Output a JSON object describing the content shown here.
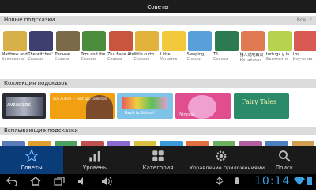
{
  "topbar": {
    "title": "Советы"
  },
  "new_tips": {
    "title": "Новые подсказки",
    "more_label": "Все",
    "items": [
      {
        "name": "Matthew and",
        "price": "Бесплатно",
        "color": "#d8b04a"
      },
      {
        "name": "The witches'",
        "price": "Сказки",
        "color": "#3d3f6e"
      },
      {
        "name": "Лесные",
        "price": "Сказки",
        "color": "#7a6a4a"
      },
      {
        "name": "Tom and the",
        "price": "Сказки",
        "color": "#4c8c3c"
      },
      {
        "name": "Zhu Bajie Ate",
        "price": "Сказки",
        "color": "#c9553e"
      },
      {
        "name": "little cutto",
        "price": "Сказки",
        "color": "#e2b23a"
      },
      {
        "name": "Little",
        "price": "Узнайте",
        "color": "#f2c93a"
      },
      {
        "name": "Sleeping",
        "price": "Сказки",
        "color": "#5aa0d8"
      },
      {
        "name": "T5",
        "price": "Сказки",
        "color": "#2c7a50"
      },
      {
        "name": "猪八戒吃西瓜",
        "price": "Китайская",
        "color": "#e07a52"
      },
      {
        "name": "tortuga y la",
        "price": "Бесплатно",
        "color": "#b7d24c"
      },
      {
        "name": "Los",
        "price": "Изучение",
        "color": "#d85a52"
      }
    ]
  },
  "collections": {
    "title": "Коллекция подсказок",
    "items": [
      {
        "label": "AVENGERS",
        "color": "#2a2d34"
      },
      {
        "label": "SOS Autism — Best app collection",
        "color": "#f0a010"
      },
      {
        "label": "Back to School",
        "color": "#7fc4e8"
      },
      {
        "label": "Princess",
        "color": "#e04e8e"
      },
      {
        "label": "Fairy Tales",
        "color": "#2a8a6a"
      }
    ]
  },
  "popup_tips": {
    "title": "Всплывающие подсказки",
    "colors": [
      "#5a7ab8",
      "#e0a030",
      "#4ca060",
      "#c05050",
      "#8a6ad0",
      "#d8c040",
      "#3a9ad8",
      "#e07040",
      "#6ab060",
      "#b060a0",
      "#4a80c0",
      "#d0a050"
    ]
  },
  "navbar": {
    "items": [
      {
        "label": "Советы",
        "icon": "star-icon",
        "active": true
      },
      {
        "label": "Уровень",
        "icon": "bar-chart-icon",
        "active": false
      },
      {
        "label": "Категория",
        "icon": "grid-icon",
        "active": false
      },
      {
        "label": "Управление приложениями",
        "icon": "gear-icon",
        "active": false
      },
      {
        "label": "Поиск",
        "icon": "search-icon",
        "active": false
      }
    ]
  },
  "systembar": {
    "time": "10:14"
  },
  "colors": {
    "accent": "#0b3c7a",
    "clock": "#3aa0e0"
  }
}
